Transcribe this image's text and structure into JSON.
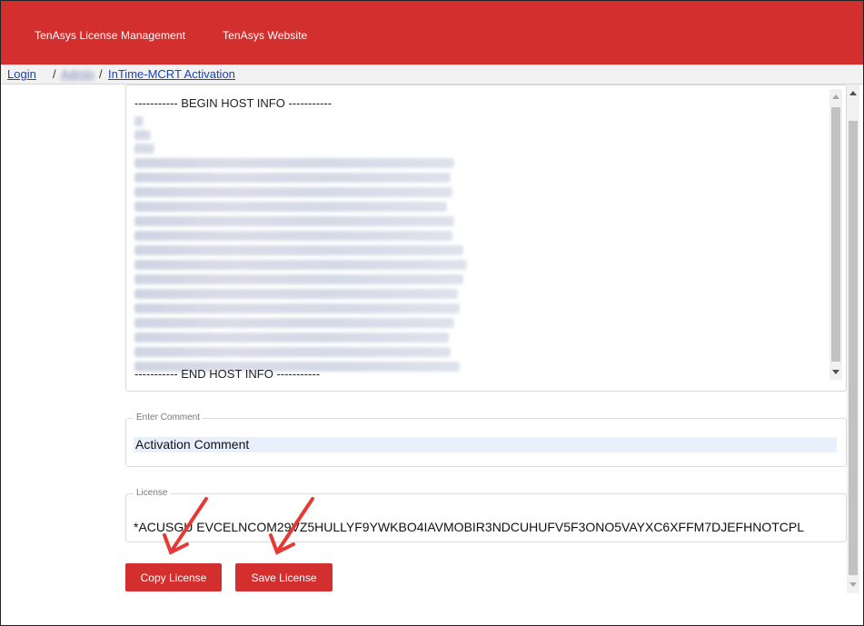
{
  "nav": {
    "license_mgmt": "TenAsys License Management",
    "website": "TenAsys Website"
  },
  "breadcrumb": {
    "login": "Login",
    "sep": "/",
    "admin": "Admin",
    "activation": "InTime-MCRT Activation"
  },
  "host_info": {
    "begin": "----------- BEGIN HOST INFO -----------",
    "end": "----------- END HOST INFO -----------"
  },
  "comment": {
    "legend": "Enter Comment",
    "value": "Activation Comment"
  },
  "license": {
    "legend": "License",
    "value": "*ACUSGU EVCELNCOM29VZ5HULLYF9YWKBO4IAVMOBIR3NDCUHUFV5F3ONO5VAYXC6XFFM7DJEFHNOTCPL"
  },
  "buttons": {
    "copy": "Copy License",
    "save": "Save License"
  },
  "colors": {
    "brand": "#d32f2f",
    "link": "#1a44b8",
    "annotation_arrow": "#e53935"
  }
}
